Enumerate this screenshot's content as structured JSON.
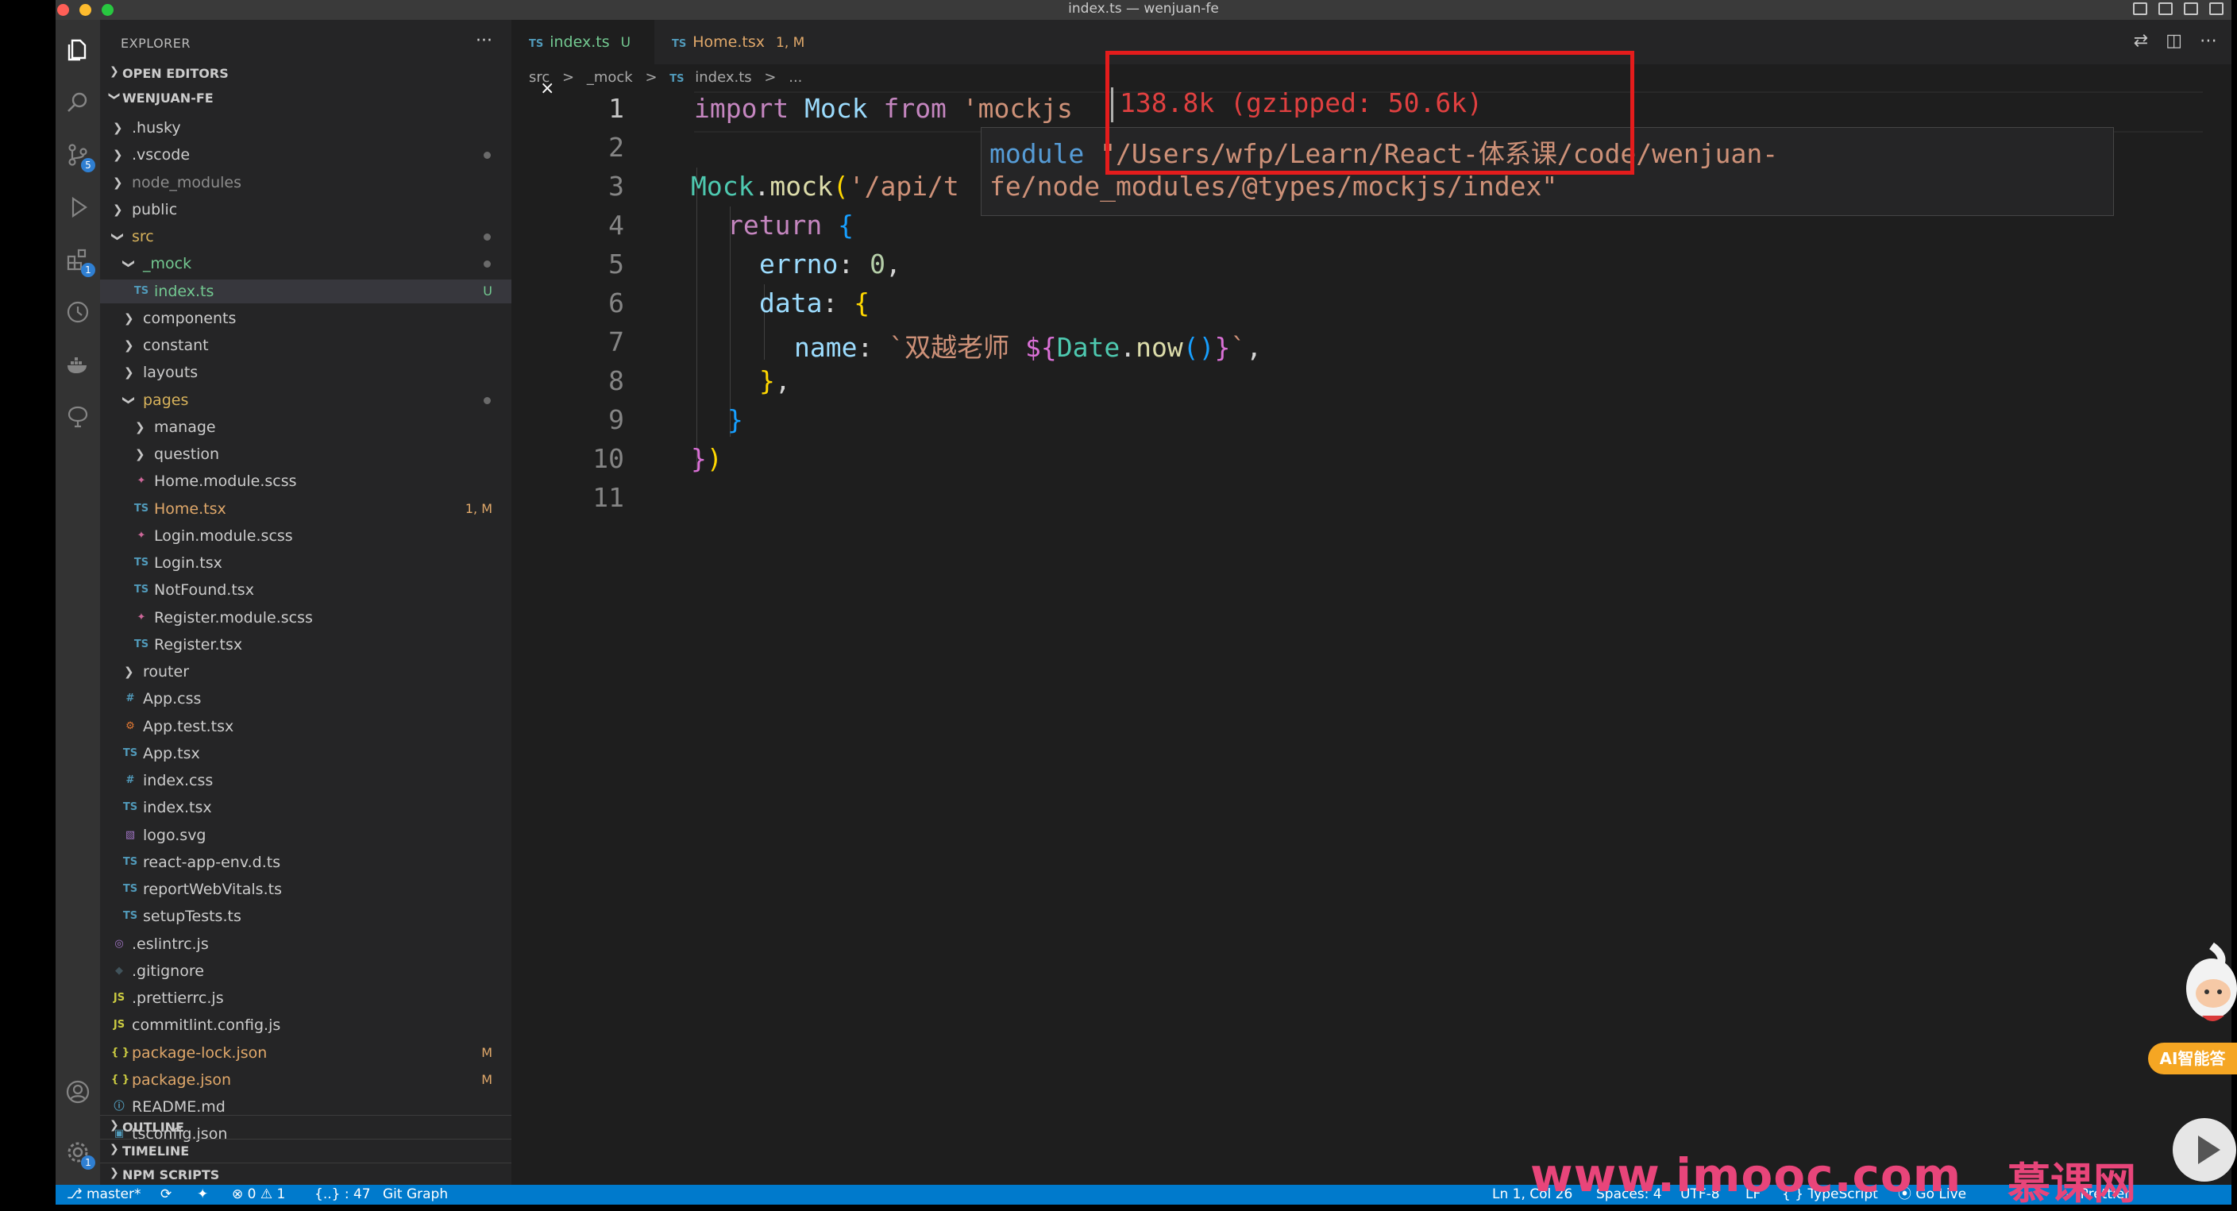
{
  "window": {
    "title": "index.ts — wenjuan-fe"
  },
  "activity_bar": {
    "scm_badge": "5",
    "extensions_badge": "1",
    "settings_badge": "1"
  },
  "sidebar": {
    "header": "EXPLORER",
    "more": "···",
    "open_editors": "OPEN EDITORS",
    "project": "WENJUAN-FE",
    "tree": [
      {
        "name": ".husky",
        "type": "folder",
        "depth": 1,
        "open": false,
        "color": "#cccccc"
      },
      {
        "name": ".vscode",
        "type": "folder",
        "depth": 1,
        "open": false,
        "color": "#cccccc",
        "dot": true
      },
      {
        "name": "node_modules",
        "type": "folder",
        "depth": 1,
        "open": false,
        "color": "#8c8c8c"
      },
      {
        "name": "public",
        "type": "folder",
        "depth": 1,
        "open": false,
        "color": "#cccccc"
      },
      {
        "name": "src",
        "type": "folder",
        "depth": 1,
        "open": true,
        "color": "#d7b25b",
        "dot": true
      },
      {
        "name": "_mock",
        "type": "folder",
        "depth": 2,
        "open": true,
        "color": "#73c991",
        "dot": true
      },
      {
        "name": "index.ts",
        "type": "ts",
        "depth": 3,
        "color": "#73c991",
        "deco": "U",
        "deco_color": "#73c991",
        "selected": true
      },
      {
        "name": "components",
        "type": "folder",
        "depth": 2,
        "open": false,
        "color": "#cccccc"
      },
      {
        "name": "constant",
        "type": "folder",
        "depth": 2,
        "open": false,
        "color": "#cccccc"
      },
      {
        "name": "layouts",
        "type": "folder",
        "depth": 2,
        "open": false,
        "color": "#cccccc"
      },
      {
        "name": "pages",
        "type": "folder",
        "depth": 2,
        "open": true,
        "color": "#d7b25b",
        "dot": true
      },
      {
        "name": "manage",
        "type": "folder",
        "depth": 3,
        "open": false,
        "color": "#cccccc"
      },
      {
        "name": "question",
        "type": "folder",
        "depth": 3,
        "open": false,
        "color": "#cccccc"
      },
      {
        "name": "Home.module.scss",
        "type": "scss",
        "depth": 3,
        "color": "#cccccc"
      },
      {
        "name": "Home.tsx",
        "type": "ts",
        "depth": 3,
        "color": "#e0a86a",
        "deco": "1, M",
        "deco_color": "#e0a86a"
      },
      {
        "name": "Login.module.scss",
        "type": "scss",
        "depth": 3,
        "color": "#cccccc"
      },
      {
        "name": "Login.tsx",
        "type": "ts",
        "depth": 3,
        "color": "#cccccc"
      },
      {
        "name": "NotFound.tsx",
        "type": "ts",
        "depth": 3,
        "color": "#cccccc"
      },
      {
        "name": "Register.module.scss",
        "type": "scss",
        "depth": 3,
        "color": "#cccccc"
      },
      {
        "name": "Register.tsx",
        "type": "ts",
        "depth": 3,
        "color": "#cccccc"
      },
      {
        "name": "router",
        "type": "folder",
        "depth": 2,
        "open": false,
        "color": "#cccccc"
      },
      {
        "name": "App.css",
        "type": "css",
        "depth": 2,
        "color": "#cccccc"
      },
      {
        "name": "App.test.tsx",
        "type": "test",
        "depth": 2,
        "color": "#cccccc"
      },
      {
        "name": "App.tsx",
        "type": "ts",
        "depth": 2,
        "color": "#cccccc"
      },
      {
        "name": "index.css",
        "type": "css",
        "depth": 2,
        "color": "#cccccc"
      },
      {
        "name": "index.tsx",
        "type": "ts",
        "depth": 2,
        "color": "#cccccc"
      },
      {
        "name": "logo.svg",
        "type": "svg",
        "depth": 2,
        "color": "#cccccc"
      },
      {
        "name": "react-app-env.d.ts",
        "type": "ts",
        "depth": 2,
        "color": "#cccccc"
      },
      {
        "name": "reportWebVitals.ts",
        "type": "ts",
        "depth": 2,
        "color": "#cccccc"
      },
      {
        "name": "setupTests.ts",
        "type": "ts",
        "depth": 2,
        "color": "#cccccc"
      },
      {
        "name": ".eslintrc.js",
        "type": "eslint",
        "depth": 1,
        "color": "#cccccc"
      },
      {
        "name": ".gitignore",
        "type": "git",
        "depth": 1,
        "color": "#cccccc"
      },
      {
        "name": ".prettierrc.js",
        "type": "js",
        "depth": 1,
        "color": "#cccccc"
      },
      {
        "name": "commitlint.config.js",
        "type": "js",
        "depth": 1,
        "color": "#cccccc"
      },
      {
        "name": "package-lock.json",
        "type": "json",
        "depth": 1,
        "color": "#e0a86a",
        "deco": "M",
        "deco_color": "#e0a86a"
      },
      {
        "name": "package.json",
        "type": "json",
        "depth": 1,
        "color": "#e0a86a",
        "deco": "M",
        "deco_color": "#e0a86a"
      },
      {
        "name": "README.md",
        "type": "md",
        "depth": 1,
        "color": "#cccccc"
      },
      {
        "name": "tsconfig.json",
        "type": "tsconfig",
        "depth": 1,
        "color": "#cccccc"
      }
    ],
    "outline": "OUTLINE",
    "timeline": "TIMELINE",
    "npm_scripts": "NPM SCRIPTS"
  },
  "tabs": [
    {
      "prefix": "TS",
      "label": "index.ts",
      "deco": "U",
      "close": "×",
      "active": true,
      "color": "#73c991"
    },
    {
      "prefix": "TS",
      "label": "Home.tsx",
      "deco": "1, M",
      "active": false,
      "color": "#e0a86a"
    }
  ],
  "breadcrumb": {
    "part1": "src",
    "sep": ">",
    "part2": "_mock",
    "part3_prefix": "TS",
    "part3": "index.ts",
    "part4": "..."
  },
  "code": {
    "line_numbers": [
      "1",
      "2",
      "3",
      "4",
      "5",
      "6",
      "7",
      "8",
      "9",
      "10",
      "11"
    ],
    "l1_import": "import",
    "l1_mock": "Mock",
    "l1_from": "from",
    "l1_str": "'mockjs",
    "l3_mock": "Mock",
    "l3_dot": ".",
    "l3_fn": "mock",
    "l3_paren": "(",
    "l3_str": "'/api/t",
    "l4_return": "return",
    "l4_brace": "{",
    "l5_key": "errno",
    "l5_colon": ": ",
    "l5_val": "0",
    "l5_comma": ",",
    "l6_key": "data",
    "l6_colon": ": ",
    "l6_brace": "{",
    "l7_key": "name",
    "l7_colon": ": ",
    "l7_str": "`双越老师 ",
    "l7_tmpl_open": "${",
    "l7_date": "Date",
    "l7_dot": ".",
    "l7_now": "now",
    "l7_parens": "()",
    "l7_tmpl_close": "}",
    "l7_tick": "`",
    "l7_comma": ",",
    "l8_brace": "}",
    "l8_comma": ",",
    "l9_brace": "}",
    "l10_brace": "}",
    "l10_paren": ")"
  },
  "inlay_hint": "138.8k (gzipped: 50.6k)",
  "hover": {
    "keyword": "module",
    "path_line1": "\"/Users/wfp/Learn/React-体系课/code/wenjuan-",
    "path_line2": "fe/node_modules/@types/mockjs/index\""
  },
  "status_bar": {
    "branch": "master*",
    "errors": "⊗ 0",
    "warnings": "⚠ 1",
    "braces": "{..} : 47",
    "git_graph": "Git Graph",
    "position": "Ln 1, Col 26",
    "spaces": "Spaces: 4",
    "encoding": "UTF-8",
    "eol": "LF",
    "language": "{ } TypeScript",
    "go_live": "Go Live",
    "prettier": "✓ Prettier"
  },
  "overlay": {
    "watermark": "www.imooc.com",
    "brand": "慕课网",
    "ai_badge": "AI智能答"
  },
  "colors": {
    "accent": "#007acc",
    "highlight_box": "#e41c1c",
    "watermark": "#e8457a"
  }
}
